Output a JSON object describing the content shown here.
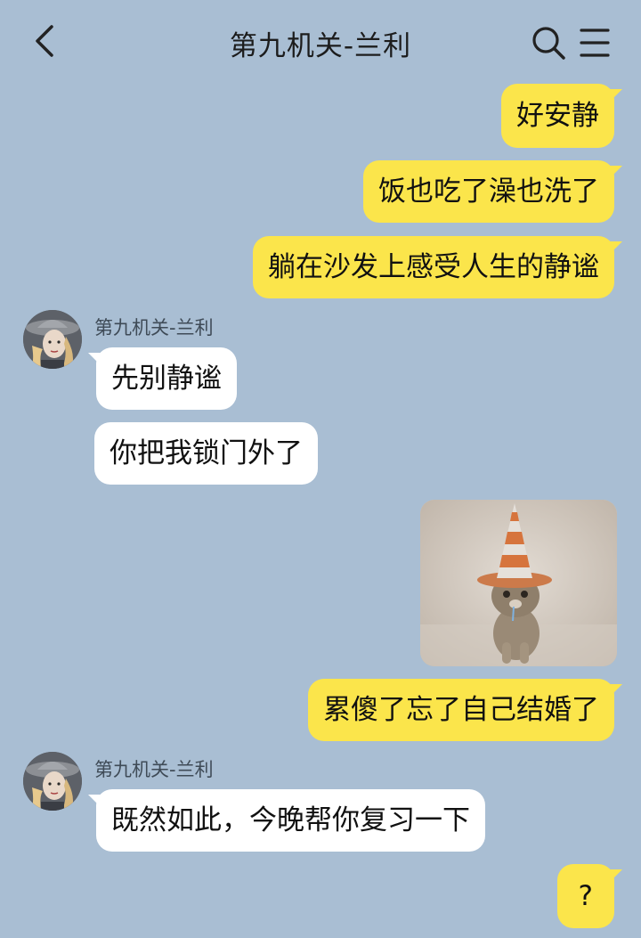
{
  "header": {
    "title": "第九机关-兰利",
    "back_icon": "chevron-left-icon",
    "search_icon": "search-icon",
    "menu_icon": "menu-icon"
  },
  "messages": [
    {
      "side": "out",
      "text": "好安静"
    },
    {
      "side": "out",
      "text": "饭也吃了澡也洗了"
    },
    {
      "side": "out",
      "text": "躺在沙发上感受人生的静谧"
    },
    {
      "side": "in",
      "sender": "第九机关-兰利",
      "text": "先别静谧"
    },
    {
      "side": "in",
      "text": "你把我锁门外了"
    },
    {
      "side": "out",
      "type": "image",
      "image": "cat-wearing-traffic-cone-sticker"
    },
    {
      "side": "out",
      "text": "累傻了忘了自己结婚了"
    },
    {
      "side": "in",
      "sender": "第九机关-兰利",
      "text": "既然如此，今晚帮你复习一下"
    },
    {
      "side": "out",
      "text": "?"
    }
  ],
  "colors": {
    "background": "#a9bed3",
    "outgoing_bubble": "#fbe54b",
    "incoming_bubble": "#ffffff"
  }
}
